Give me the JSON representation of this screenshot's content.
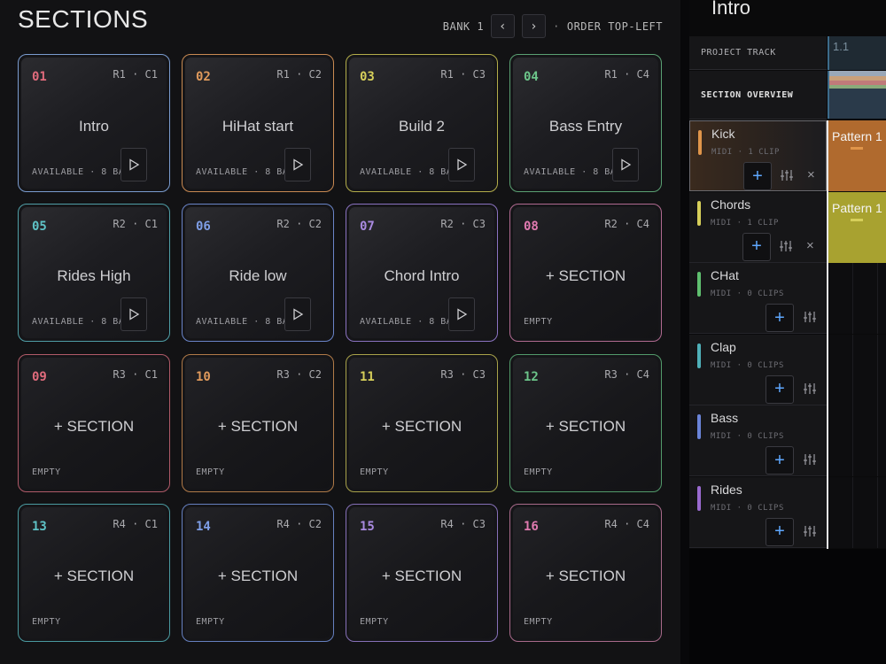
{
  "sections_panel": {
    "title": "SECTIONS",
    "bank_label": "BANK 1",
    "prev_glyph": "‹",
    "next_glyph": "›",
    "separator": "·",
    "order_label": "ORDER TOP-LEFT"
  },
  "tiles": [
    {
      "num": "01",
      "pos": "R1 · C1",
      "name": "Intro",
      "status": "AVAILABLE · 8 BARS",
      "color": "#e06b7c",
      "border": "#7a9ccf",
      "play": true
    },
    {
      "num": "02",
      "pos": "R1 · C2",
      "name": "HiHat start",
      "status": "AVAILABLE · 8 BARS",
      "color": "#e09a5c",
      "border": "#c98a52",
      "play": true
    },
    {
      "num": "03",
      "pos": "R1 · C3",
      "name": "Build 2",
      "status": "AVAILABLE · 8 BARS",
      "color": "#d6cf5a",
      "border": "#b3ad4a",
      "play": true
    },
    {
      "num": "04",
      "pos": "R1 · C4",
      "name": "Bass Entry",
      "status": "AVAILABLE · 8 BARS",
      "color": "#6cc58a",
      "border": "#5aa072",
      "play": true
    },
    {
      "num": "05",
      "pos": "R2 · C1",
      "name": "Rides High",
      "status": "AVAILABLE · 8 BARS",
      "color": "#5ec2c6",
      "border": "#4f9ea6",
      "play": true
    },
    {
      "num": "06",
      "pos": "R2 · C2",
      "name": "Ride low",
      "status": "AVAILABLE · 8 BARS",
      "color": "#7e9ee6",
      "border": "#6a84c8",
      "play": true
    },
    {
      "num": "07",
      "pos": "R2 · C3",
      "name": "Chord Intro",
      "status": "AVAILABLE · 8 BARS",
      "color": "#a98ae0",
      "border": "#8a72c0",
      "play": true
    },
    {
      "num": "08",
      "pos": "R2 · C4",
      "name": "+ SECTION",
      "status": "EMPTY",
      "color": "#e07ab0",
      "border": "#b06a90",
      "play": false
    },
    {
      "num": "09",
      "pos": "R3 · C1",
      "name": "+ SECTION",
      "status": "EMPTY",
      "color": "#e06b7c",
      "border": "#b05a68",
      "play": false
    },
    {
      "num": "10",
      "pos": "R3 · C2",
      "name": "+ SECTION",
      "status": "EMPTY",
      "color": "#e09a5c",
      "border": "#b07a48",
      "play": false
    },
    {
      "num": "11",
      "pos": "R3 · C3",
      "name": "+ SECTION",
      "status": "EMPTY",
      "color": "#d6cf5a",
      "border": "#a8a24a",
      "play": false
    },
    {
      "num": "12",
      "pos": "R3 · C4",
      "name": "+ SECTION",
      "status": "EMPTY",
      "color": "#6cc58a",
      "border": "#529a6a",
      "play": false
    },
    {
      "num": "13",
      "pos": "R4 · C1",
      "name": "+ SECTION",
      "status": "EMPTY",
      "color": "#5ec2c6",
      "border": "#4a9aa0",
      "play": false
    },
    {
      "num": "14",
      "pos": "R4 · C2",
      "name": "+ SECTION",
      "status": "EMPTY",
      "color": "#7e9ee6",
      "border": "#6680c0",
      "play": false
    },
    {
      "num": "15",
      "pos": "R4 · C3",
      "name": "+ SECTION",
      "status": "EMPTY",
      "color": "#a98ae0",
      "border": "#8670b8",
      "play": false
    },
    {
      "num": "16",
      "pos": "R4 · C4",
      "name": "+ SECTION",
      "status": "EMPTY",
      "color": "#e07ab0",
      "border": "#a86a8a",
      "play": false
    }
  ],
  "track_panel": {
    "song_title": "Intro",
    "project_track_label": "PROJECT TRACK",
    "section_overview_label": "SECTION OVERVIEW",
    "ruler_marker": "1.1"
  },
  "tracks": [
    {
      "name": "Kick",
      "meta": "MIDI · 1 CLIP",
      "color": "#e0954a",
      "selected": true,
      "has_close": true,
      "clip": {
        "label": "Pattern 1",
        "color": "#b06a2e"
      }
    },
    {
      "name": "Chords",
      "meta": "MIDI · 1 CLIP",
      "color": "#d6cf5a",
      "selected": false,
      "has_close": true,
      "clip": {
        "label": "Pattern 1",
        "color": "#a8a230"
      }
    },
    {
      "name": "CHat",
      "meta": "MIDI · 0 CLIPS",
      "color": "#5fbf6f",
      "selected": false,
      "has_close": false,
      "clip": null
    },
    {
      "name": "Clap",
      "meta": "MIDI · 0 CLIPS",
      "color": "#4fb0b8",
      "selected": false,
      "has_close": false,
      "clip": null
    },
    {
      "name": "Bass",
      "meta": "MIDI · 0 CLIPS",
      "color": "#6a84d8",
      "selected": false,
      "has_close": false,
      "clip": null
    },
    {
      "name": "Rides",
      "meta": "MIDI · 0 CLIPS",
      "color": "#9a6ad0",
      "selected": false,
      "has_close": false,
      "clip": null
    }
  ],
  "icons": {
    "add": "+",
    "close": "×"
  }
}
